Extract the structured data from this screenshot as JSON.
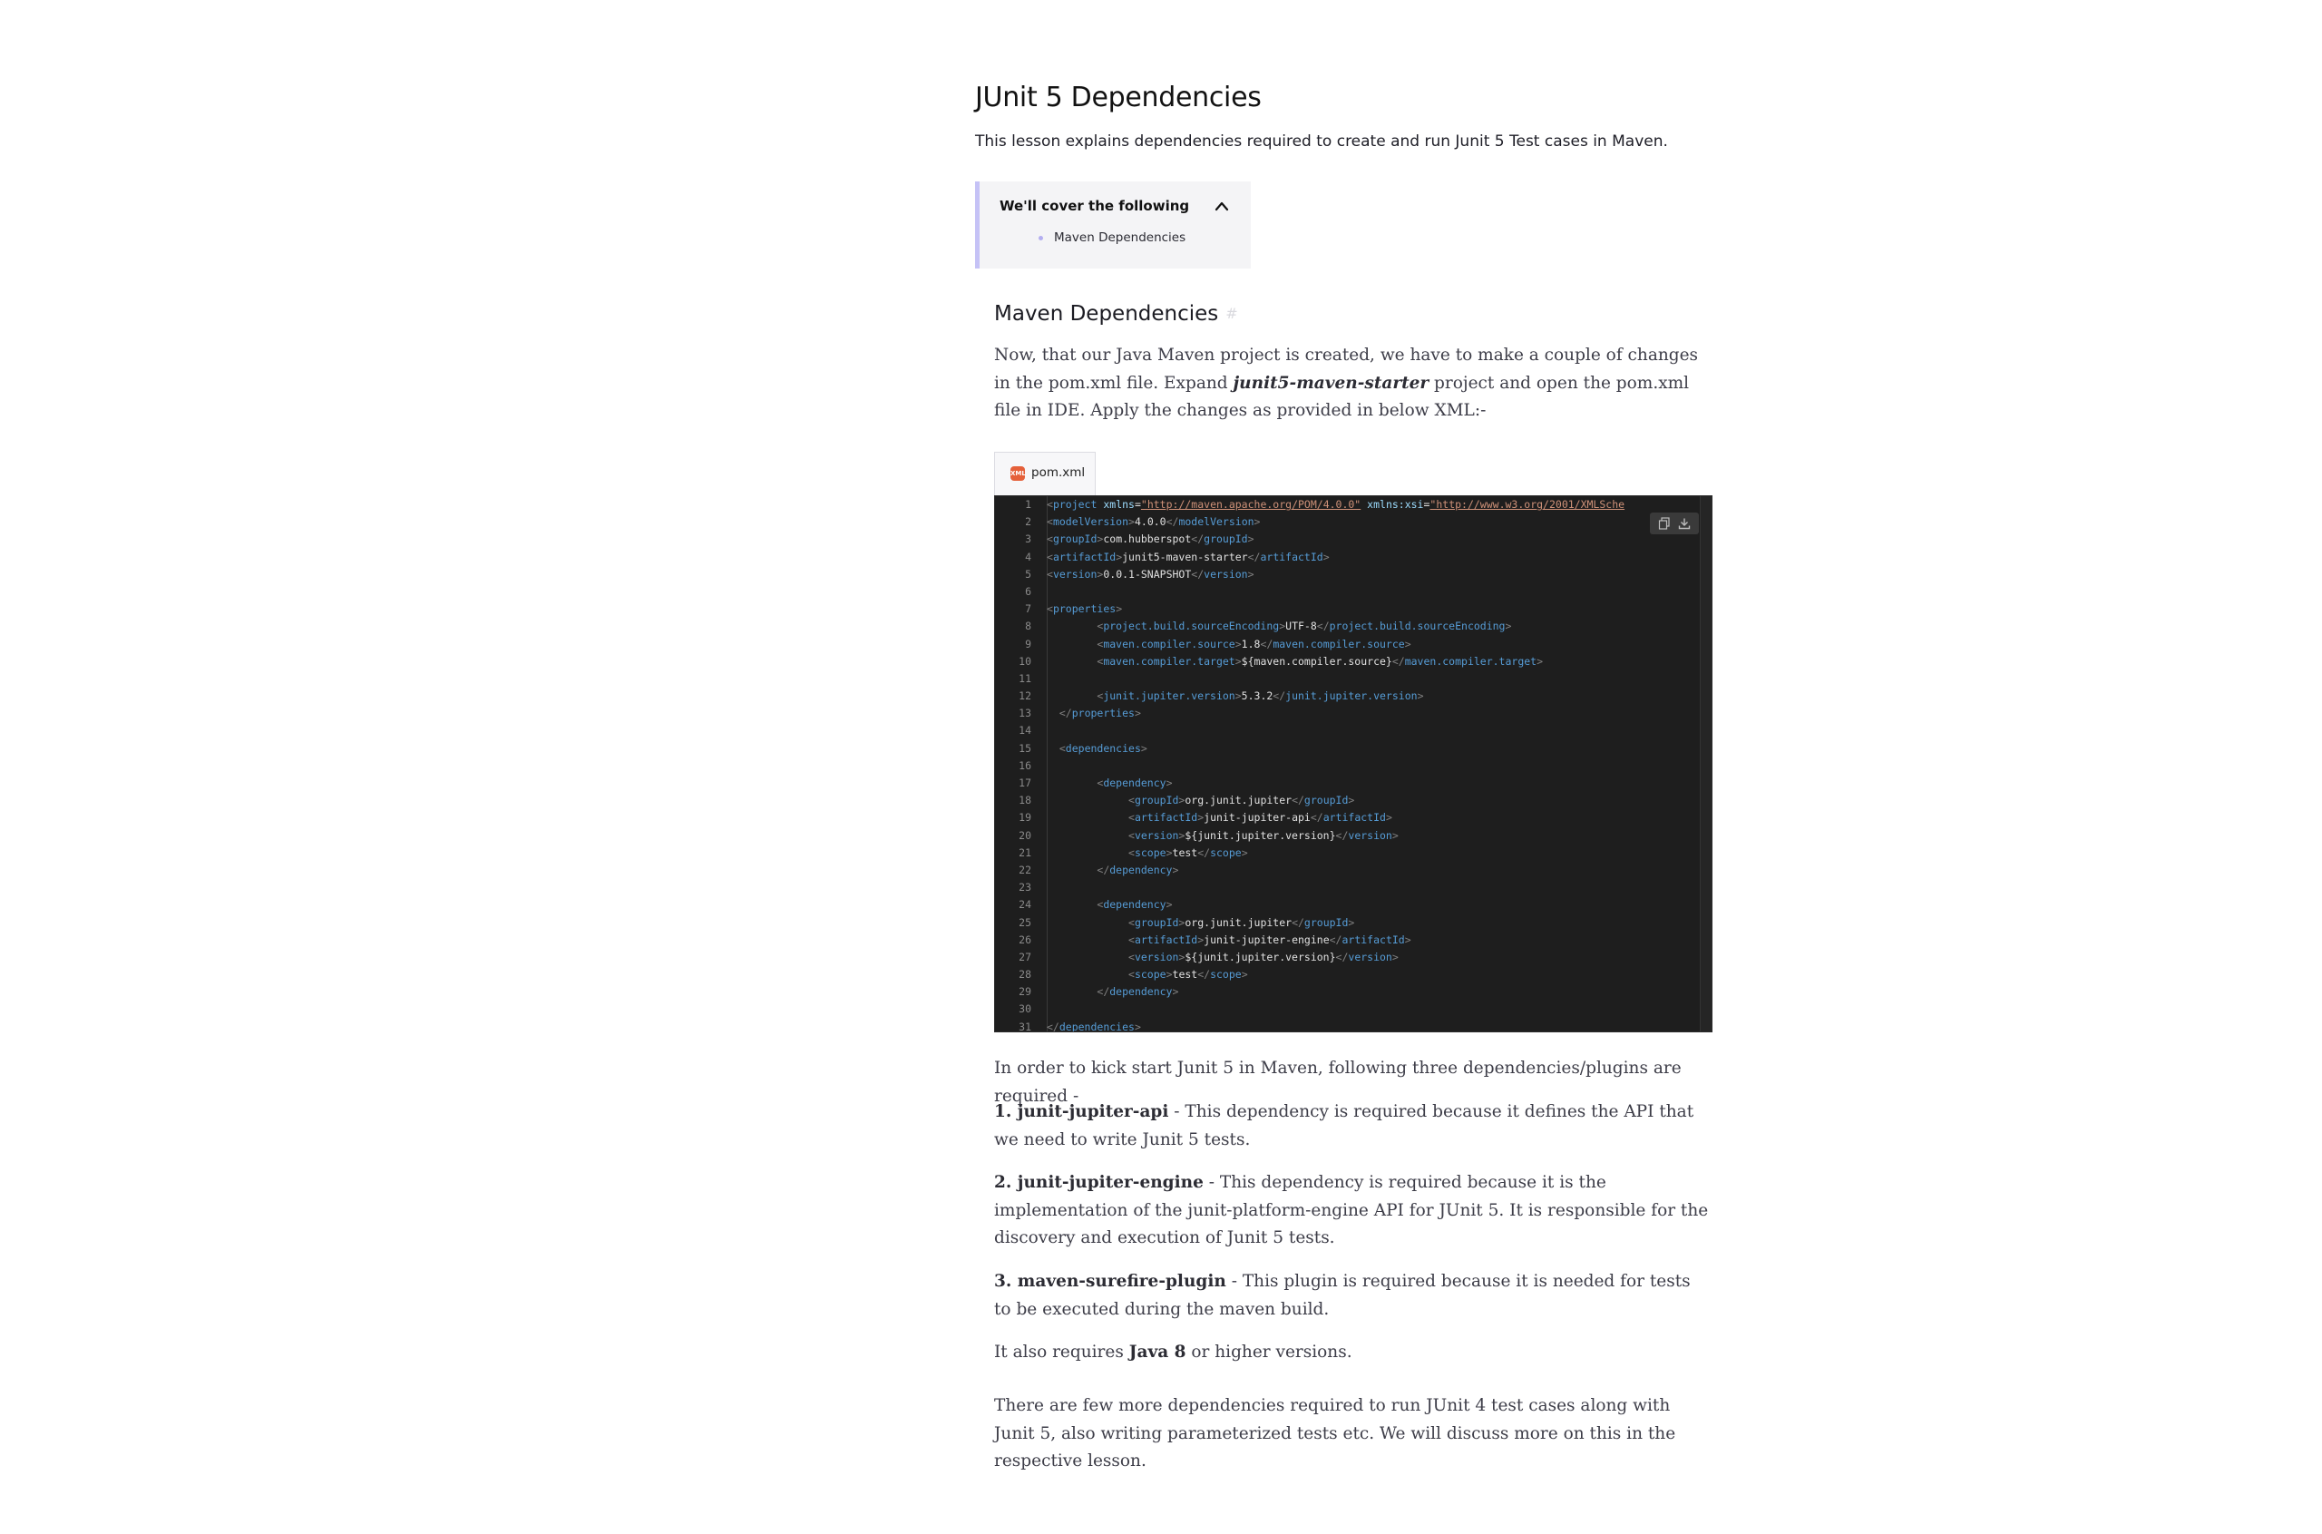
{
  "lesson": {
    "title": "JUnit 5 Dependencies",
    "summary": "This lesson explains dependencies required to create and run Junit 5 Test cases in Maven."
  },
  "toc": {
    "heading": "We'll cover the following",
    "items": [
      "Maven Dependencies"
    ]
  },
  "section": {
    "heading": "Maven Dependencies",
    "anchor": "#",
    "intro": {
      "before": "Now, that our Java Maven project is created, we have to make a couple of changes in the pom.xml file. Expand ",
      "emph": "junit5-maven-starter",
      "after": " project and open the pom.xml file in IDE. Apply the changes as provided in below XML:-"
    }
  },
  "code_block": {
    "file_tab": "pom.xml",
    "file_icon": "xml-file-icon",
    "line_numbers": [
      "1",
      "2",
      "3",
      "4",
      "5",
      "6",
      "7",
      "8",
      "9",
      "10",
      "11",
      "12",
      "13",
      "14",
      "15",
      "16",
      "17",
      "18",
      "19",
      "20",
      "21",
      "22",
      "23",
      "24",
      "25",
      "26",
      "27",
      "28",
      "29",
      "30",
      "31"
    ],
    "project_open": {
      "tag": "project",
      "xmlns_attr": "xmlns",
      "xmlns_value": "\"http://maven.apache.org/POM/4.0.0\"",
      "xsi_attr": "xmlns:xsi",
      "xsi_value": "\"http://www.w3.org/2001/XMLSche"
    },
    "lines": [
      {
        "indent": "",
        "tag": "modelVersion",
        "value": "4.0.0"
      },
      {
        "indent": "",
        "tag": "groupId",
        "value": "com.hubberspot"
      },
      {
        "indent": "",
        "tag": "artifactId",
        "value": "junit5-maven-starter"
      },
      {
        "indent": "",
        "tag": "version",
        "value": "0.0.1-SNAPSHOT"
      },
      {
        "indent": "",
        "blank": true
      },
      {
        "indent": "",
        "open": "properties"
      },
      {
        "indent": "        ",
        "tag": "project.build.sourceEncoding",
        "value": "UTF-8"
      },
      {
        "indent": "        ",
        "tag": "maven.compiler.source",
        "value": "1.8"
      },
      {
        "indent": "        ",
        "tag": "maven.compiler.target",
        "value": "${maven.compiler.source}"
      },
      {
        "indent": "",
        "blank": true
      },
      {
        "indent": "        ",
        "tag": "junit.jupiter.version",
        "value": "5.3.2"
      },
      {
        "indent": "  ",
        "close": "properties"
      },
      {
        "indent": "",
        "blank": true
      },
      {
        "indent": "  ",
        "open": "dependencies"
      },
      {
        "indent": "",
        "blank": true
      },
      {
        "indent": "        ",
        "open": "dependency"
      },
      {
        "indent": "             ",
        "tag": "groupId",
        "value": "org.junit.jupiter"
      },
      {
        "indent": "             ",
        "tag": "artifactId",
        "value": "junit-jupiter-api"
      },
      {
        "indent": "             ",
        "tag": "version",
        "value": "${junit.jupiter.version}"
      },
      {
        "indent": "             ",
        "tag": "scope",
        "value": "test"
      },
      {
        "indent": "        ",
        "close": "dependency"
      },
      {
        "indent": "",
        "blank": true
      },
      {
        "indent": "        ",
        "open": "dependency"
      },
      {
        "indent": "             ",
        "tag": "groupId",
        "value": "org.junit.jupiter"
      },
      {
        "indent": "             ",
        "tag": "artifactId",
        "value": "junit-jupiter-engine"
      },
      {
        "indent": "             ",
        "tag": "version",
        "value": "${junit.jupiter.version}"
      },
      {
        "indent": "             ",
        "tag": "scope",
        "value": "test"
      },
      {
        "indent": "        ",
        "close": "dependency"
      },
      {
        "indent": "",
        "blank": true
      },
      {
        "indent": "",
        "close": "dependencies"
      }
    ],
    "copy_icon": "copy-icon",
    "download_icon": "download-icon"
  },
  "requirements": {
    "lead": "In order to kick start Junit 5 in Maven, following three dependencies/plugins are required -",
    "items": [
      {
        "name": "1. junit-jupiter-api",
        "desc": " - This dependency is required because it defines the API that we need to write Junit 5 tests."
      },
      {
        "name": "2. junit-jupiter-engine",
        "desc": " - This dependency is required because it is the implementation of the junit-platform-engine API for JUnit 5. It is responsible for the discovery and execution of Junit 5 tests."
      },
      {
        "name": "3. maven-surefire-plugin",
        "desc": " - This plugin is required because it is needed for tests to be executed during the maven build."
      }
    ],
    "java_before": "It also requires ",
    "java_bold": "Java 8",
    "java_after": " or higher versions.",
    "closing": "There are few more dependencies required to run JUnit 4 test cases along with Junit 5, also writing parameterized tests etc. We will discuss more on this in the respective lesson."
  }
}
